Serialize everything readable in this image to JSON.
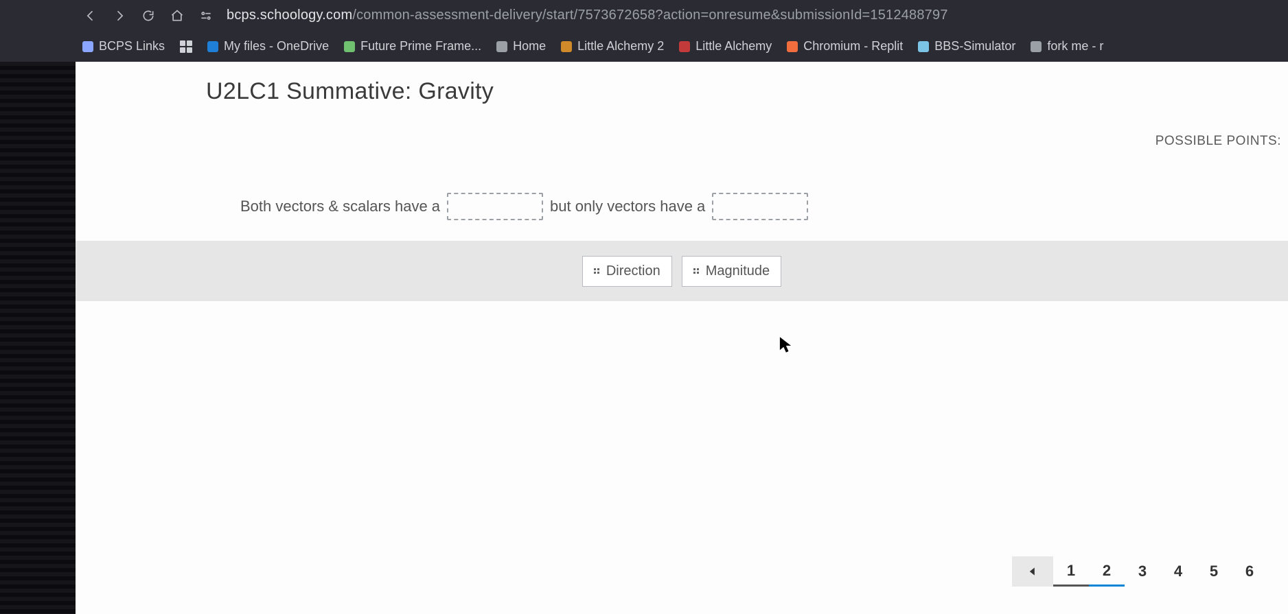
{
  "browser": {
    "url_prefix": "bcps.schoology.com",
    "url_rest": "/common-assessment-delivery/start/7573672658?action=onresume&submissionId=1512488797",
    "bookmarks": [
      {
        "label": "BCPS Links",
        "fav": "#8aa6ff",
        "dn": "bcps-links"
      },
      {
        "label": "",
        "fav": "apps",
        "dn": "apps"
      },
      {
        "label": "My files - OneDrive",
        "fav": "#1f7ed6",
        "dn": "onedrive"
      },
      {
        "label": "Future Prime Frame...",
        "fav": "#6fc06f",
        "dn": "future-prime-frame"
      },
      {
        "label": "Home",
        "fav": "#9aa0a6",
        "dn": "home"
      },
      {
        "label": "Little Alchemy 2",
        "fav": "#d08a2a",
        "dn": "little-alchemy-2"
      },
      {
        "label": "Little Alchemy",
        "fav": "#c23a3a",
        "dn": "little-alchemy"
      },
      {
        "label": "Chromium - Replit",
        "fav": "#f26d3d",
        "dn": "chromium-replit"
      },
      {
        "label": "BBS-Simulator",
        "fav": "#7cc4e6",
        "dn": "bbs-simulator"
      },
      {
        "label": "fork me - r",
        "fav": "#9aa0a6",
        "dn": "fork-me"
      }
    ]
  },
  "assessment": {
    "title": "U2LC1 Summative: Gravity",
    "possible_points_label": "POSSIBLE POINTS:",
    "sentence_part1": "Both vectors & scalars have  a",
    "sentence_part2": "but only vectors have a",
    "choices": [
      {
        "label": "Direction",
        "dn": "choice-direction"
      },
      {
        "label": "Magnitude",
        "dn": "choice-magnitude"
      }
    ],
    "pager": {
      "pages": [
        "1",
        "2",
        "3",
        "4",
        "5",
        "6"
      ],
      "current_index": 1
    }
  }
}
